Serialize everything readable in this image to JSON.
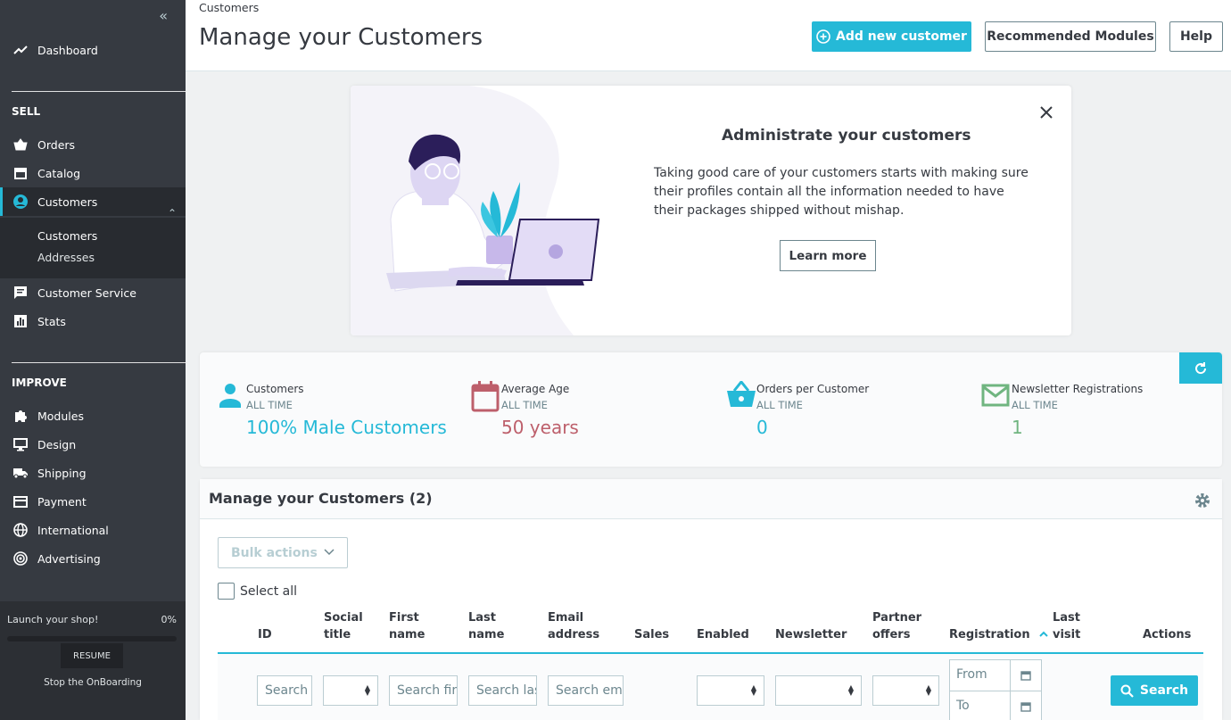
{
  "sidebar": {
    "collapse_icon": "double-chevron-left-icon",
    "dashboard": "Dashboard",
    "sell_title": "SELL",
    "improve_title": "IMPROVE",
    "items": {
      "orders": "Orders",
      "catalog": "Catalog",
      "customers": "Customers",
      "customer_service": "Customer Service",
      "stats": "Stats",
      "modules": "Modules",
      "design": "Design",
      "shipping": "Shipping",
      "payment": "Payment",
      "international": "International",
      "advertising": "Advertising"
    },
    "submenu": {
      "customers": "Customers",
      "addresses": "Addresses"
    },
    "onboarding": {
      "title": "Launch your shop!",
      "percent": "0%",
      "progress": 0,
      "resume": "RESUME",
      "stop": "Stop the OnBoarding"
    }
  },
  "header": {
    "breadcrumb": "Customers",
    "title": "Manage your Customers",
    "add_button": "Add new customer",
    "modules_button": "Recommended Modules",
    "help_button": "Help"
  },
  "banner": {
    "title": "Administrate your customers",
    "text": "Taking good care of your customers starts with making sure their profiles contain all the information needed to have their packages shipped without mishap.",
    "learn_more": "Learn more"
  },
  "kpis": [
    {
      "title": "Customers",
      "period": "ALL TIME",
      "value": "100% Male Customers",
      "color": "#25b9d7",
      "icon": "person-icon"
    },
    {
      "title": "Average Age",
      "period": "ALL TIME",
      "value": "50 years",
      "color": "#bd5f6b",
      "icon": "calendar-icon"
    },
    {
      "title": "Orders per Customer",
      "period": "ALL TIME",
      "value": "0",
      "color": "#25b9d7",
      "icon": "basket-icon"
    },
    {
      "title": "Newsletter Registrations",
      "period": "ALL TIME",
      "value": "1",
      "color": "#70b580",
      "icon": "envelope-icon"
    }
  ],
  "grid": {
    "title": "Manage your Customers (2)",
    "bulk_actions": "Bulk actions",
    "select_all": "Select all",
    "columns": {
      "id": "ID",
      "social_title": [
        "Social",
        "title"
      ],
      "first_name": [
        "First",
        "name"
      ],
      "last_name": [
        "Last",
        "name"
      ],
      "email": [
        "Email",
        "address"
      ],
      "sales": "Sales",
      "enabled": "Enabled",
      "newsletter": "Newsletter",
      "partner": [
        "Partner",
        "offers"
      ],
      "registration": "Registration",
      "last_visit": [
        "Last",
        "visit"
      ],
      "actions": "Actions"
    },
    "filters": {
      "id_placeholder": "Search",
      "first_name_placeholder": "Search first name",
      "last_name_placeholder": "Search last name",
      "email_placeholder": "Search email",
      "date_from": "From",
      "date_to": "To",
      "search_button": "Search"
    }
  }
}
